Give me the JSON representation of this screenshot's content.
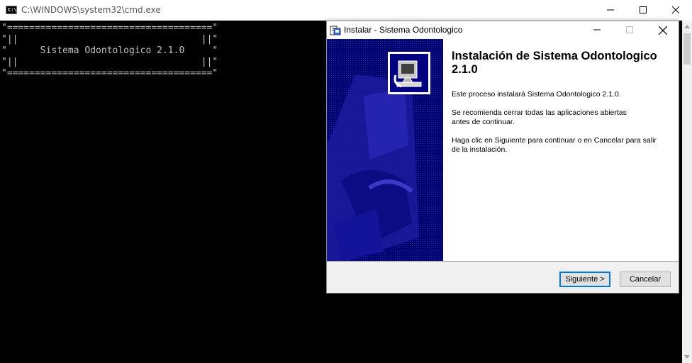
{
  "cmd": {
    "title": "C:\\WINDOWS\\system32\\cmd.exe",
    "icon_label": "C:\\",
    "lines": [
      "\"=====================================\"",
      "\"||                                 ||\"",
      "\"      Sistema Odontologico 2.1.0     \"",
      "\"||                                 ||\"",
      "\"=====================================\""
    ]
  },
  "installer": {
    "title": "Instalar - Sistema Odontologico",
    "heading": "Instalación de Sistema Odontologico 2.1.0",
    "para1": "Este proceso instalará Sistema Odontologico 2.1.0.",
    "para2_line1": "Se recomienda cerrar todas las aplicaciones abiertas",
    "para2_line2": "antes de continuar.",
    "para3_line1": "Haga clic en Siguiente para continuar o en Cancelar para salir",
    "para3_line2": "de la instalación.",
    "next_label": "Siguiente >",
    "cancel_label": "Cancelar"
  },
  "colors": {
    "banner_dark": "#00006e",
    "banner_light": "#1f1fa8",
    "accent": "#0078d7"
  }
}
